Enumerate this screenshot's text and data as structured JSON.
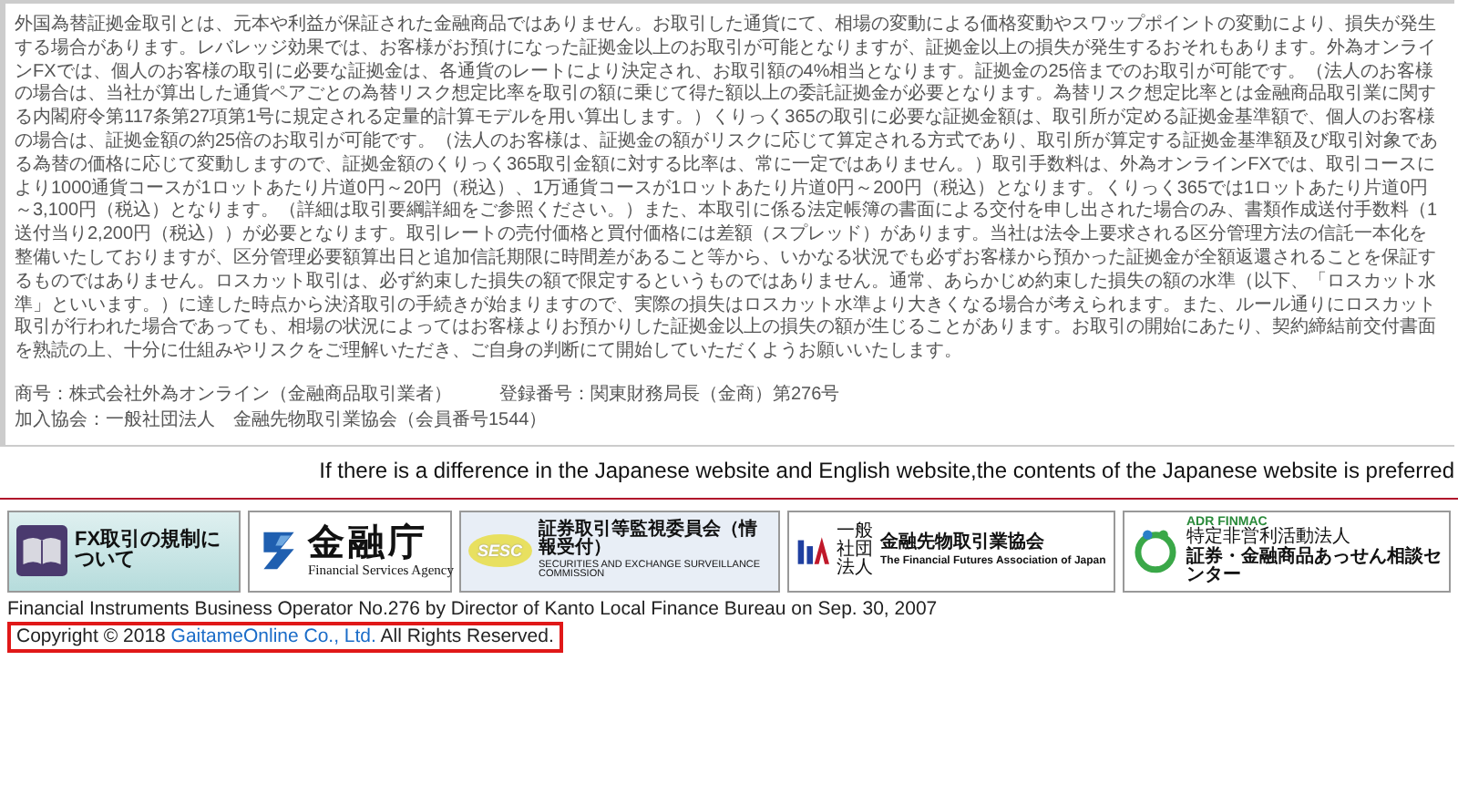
{
  "notice": {
    "text": "外国為替証拠金取引とは、元本や利益が保証された金融商品ではありません。お取引した通貨にて、相場の変動による価格変動やスワップポイントの変動により、損失が発生する場合があります。レバレッジ効果では、お客様がお預けになった証拠金以上のお取引が可能となりますが、証拠金以上の損失が発生するおそれもあります。外為オンラインFXでは、個人のお客様の取引に必要な証拠金は、各通貨のレートにより決定され、お取引額の4%相当となります。証拠金の25倍までのお取引が可能です。（法人のお客様の場合は、当社が算出した通貨ペアごとの為替リスク想定比率を取引の額に乗じて得た額以上の委託証拠金が必要となります。為替リスク想定比率とは金融商品取引業に関する内閣府令第117条第27項第1号に規定される定量的計算モデルを用い算出します。）くりっく365の取引に必要な証拠金額は、取引所が定める証拠金基準額で、個人のお客様の場合は、証拠金額の約25倍のお取引が可能です。（法人のお客様は、証拠金の額がリスクに応じて算定される方式であり、取引所が算定する証拠金基準額及び取引対象である為替の価格に応じて変動しますので、証拠金額のくりっく365取引金額に対する比率は、常に一定ではありません。）取引手数料は、外為オンラインFXでは、取引コースにより1000通貨コースが1ロットあたり片道0円～20円（税込）、1万通貨コースが1ロットあたり片道0円～200円（税込）となります。くりっく365では1ロットあたり片道0円～3,100円（税込）となります。（詳細は取引要綱詳細をご参照ください。）また、本取引に係る法定帳簿の書面による交付を申し出された場合のみ、書類作成送付手数料（1送付当り2,200円（税込））が必要となります。取引レートの売付価格と買付価格には差額（スプレッド）があります。当社は法令上要求される区分管理方法の信託一本化を整備いたしておりますが、区分管理必要額算出日と追加信託期限に時間差があること等から、いかなる状況でも必ずお客様から預かった証拠金が全額返還されることを保証するものではありません。ロスカット取引は、必ず約束した損失の額で限定するというものではありません。通常、あらかじめ約束した損失の額の水準（以下、「ロスカット水準」といいます。）に達した時点から決済取引の手続きが始まりますので、実際の損失はロスカット水準より大きくなる場合が考えられます。また、ルール通りにロスカット取引が行われた場合であっても、相場の状況によってはお客様よりお預かりした証拠金以上の損失の額が生じることがあります。お取引の開始にあたり、契約締結前交付書面を熟読の上、十分に仕組みやリスクをご理解いただき、ご自身の判断にて開始していただくようお願いいたします。",
    "company": "商号：株式会社外為オンライン（金融商品取引業者）",
    "registration": "登録番号：関東財務局長（金商）第276号",
    "association": "加入協会：一般社団法人　金融先物取引業協会（会員番号1544）"
  },
  "language_note": "If there is a difference in the Japanese website and English website,the contents of the Japanese website is preferred",
  "banners": [
    {
      "kind": "book",
      "lines": [
        "FX取引の規制について"
      ]
    },
    {
      "kind": "fsa",
      "lines": [
        "金融庁",
        "Financial Services Agency"
      ]
    },
    {
      "kind": "sesc",
      "badge": "SESC",
      "lines": [
        "証券取引等監視委員会（情報受付）",
        "SECURITIES AND EXCHANGE SURVEILLANCE COMMISSION"
      ]
    },
    {
      "kind": "ffaj",
      "prefix": "一般社団法人",
      "lines": [
        "金融先物取引業協会",
        "The Financial Futures Association of Japan"
      ]
    },
    {
      "kind": "finmac",
      "lines": [
        "ADR FINMAC",
        "特定非営利活動法人",
        "証券・金融商品あっせん相談センター"
      ]
    }
  ],
  "footer": {
    "operator": "Financial Instruments Business Operator No.276 by Director of Kanto Local Finance Bureau on Sep. 30, 2007",
    "copyright_before": "Copyright © 2018",
    "copyright_link": "GaitameOnline Co., Ltd.",
    "copyright_after": "All Rights Reserved.",
    "highlighted": true
  }
}
